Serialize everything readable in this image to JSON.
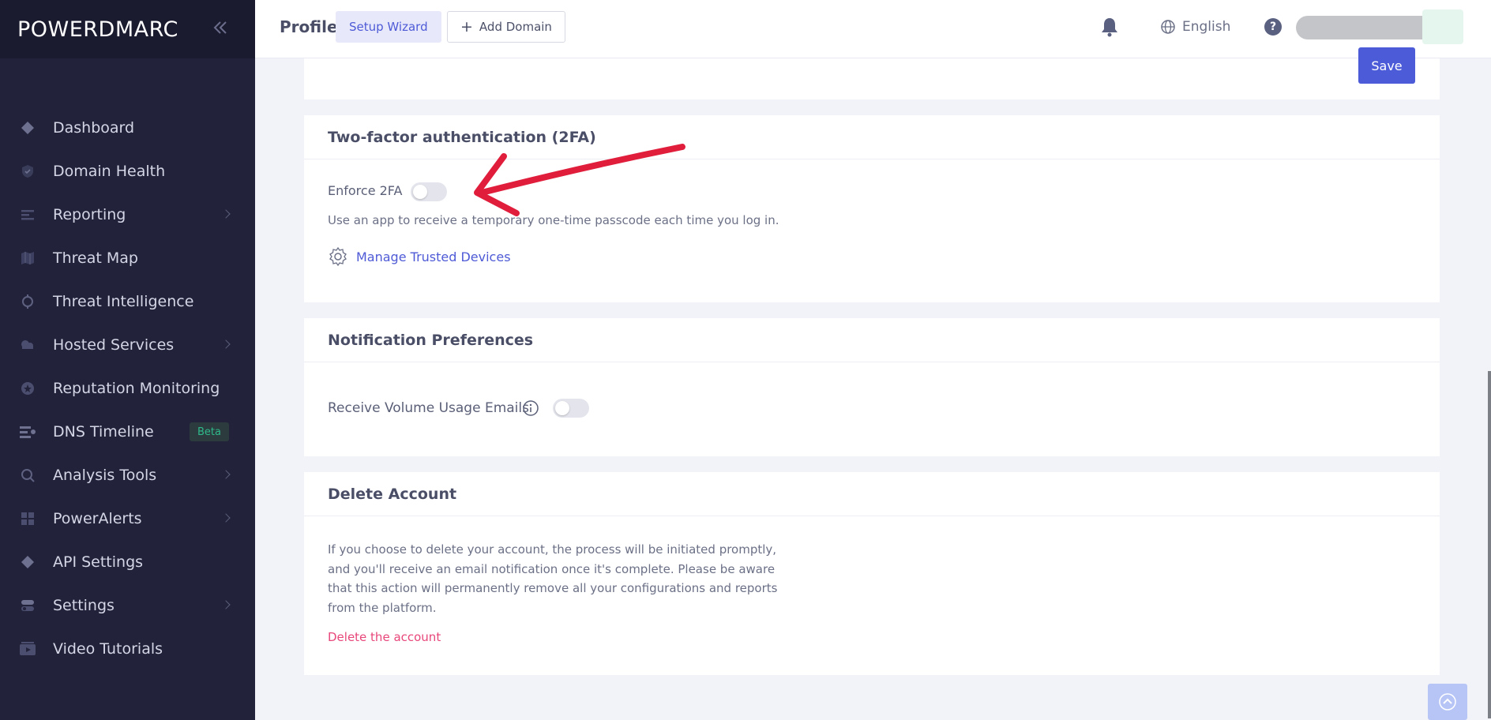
{
  "app": {
    "logo": "POWERDMARC"
  },
  "sidebar": {
    "items": [
      {
        "label": "Dashboard",
        "icon": "diamond-icon",
        "chevron": false
      },
      {
        "label": "Domain Health",
        "icon": "shield-icon",
        "chevron": false
      },
      {
        "label": "Reporting",
        "icon": "reporting-icon",
        "chevron": true
      },
      {
        "label": "Threat Map",
        "icon": "map-icon",
        "chevron": false
      },
      {
        "label": "Threat Intelligence",
        "icon": "target-icon",
        "chevron": false
      },
      {
        "label": "Hosted Services",
        "icon": "cloud-icon",
        "chevron": true
      },
      {
        "label": "Reputation Monitoring",
        "icon": "badge-icon",
        "chevron": false
      },
      {
        "label": "DNS Timeline",
        "icon": "timeline-icon",
        "chevron": false,
        "badge": "Beta"
      },
      {
        "label": "Analysis Tools",
        "icon": "magnifier-icon",
        "chevron": true
      },
      {
        "label": "PowerAlerts",
        "icon": "grid-icon",
        "chevron": true
      },
      {
        "label": "API Settings",
        "icon": "diamond-icon",
        "chevron": false
      },
      {
        "label": "Settings",
        "icon": "toggle-icon",
        "chevron": true
      },
      {
        "label": "Video Tutorials",
        "icon": "video-icon",
        "chevron": false
      }
    ]
  },
  "header": {
    "title": "Profile",
    "setup_wizard": "Setup Wizard",
    "add_domain": "Add Domain",
    "language": "English",
    "help": "?"
  },
  "profile_card": {
    "save": "Save"
  },
  "two_factor": {
    "title": "Two-factor authentication (2FA)",
    "enforce_label": "Enforce 2FA",
    "description": "Use an app to receive a temporary one-time passcode each time you log in.",
    "manage_devices": "Manage Trusted Devices"
  },
  "notifications": {
    "title": "Notification Preferences",
    "volume_emails": "Receive Volume Usage Emails"
  },
  "delete_account": {
    "title": "Delete Account",
    "lines": [
      "If you choose to delete your account, the process will be initiated promptly,",
      "and you'll receive an email notification once it's complete. Please be aware",
      "that this action will permanently remove all your configurations and reports",
      "from the platform."
    ],
    "link": "Delete the account"
  },
  "colors": {
    "sidebar": "#22223a",
    "accent": "#4c5bd8",
    "danger": "#e8477a",
    "annotation_arrow": "#e01e3c"
  }
}
